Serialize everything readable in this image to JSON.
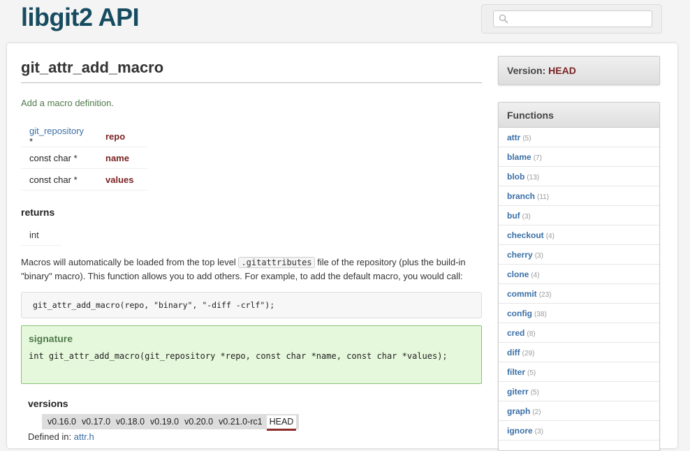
{
  "header": {
    "site_title": "libgit2 API",
    "search_placeholder": ""
  },
  "main": {
    "title": "git_attr_add_macro",
    "summary": "Add a macro definition.",
    "params": [
      {
        "type": "git_repository",
        "type_is_link": true,
        "type_suffix": " *",
        "name": "repo"
      },
      {
        "type": "const char *",
        "type_is_link": false,
        "type_suffix": "",
        "name": "name"
      },
      {
        "type": "const char *",
        "type_is_link": false,
        "type_suffix": "",
        "name": "values"
      }
    ],
    "returns_heading": "returns",
    "returns_type": "int",
    "description_before": "Macros will automatically be loaded from the top level ",
    "description_code": ".gitattributes",
    "description_after": " file of the repository (plus the build-in \"binary\" macro). This function allows you to add others. For example, to add the default macro, you would call:",
    "example_code": "git_attr_add_macro(repo, \"binary\", \"-diff -crlf\");",
    "signature_heading": "signature",
    "signature_code": "int git_attr_add_macro(git_repository *repo, const char *name, const char *values);",
    "versions_heading": "versions",
    "versions": [
      "v0.16.0",
      "v0.17.0",
      "v0.18.0",
      "v0.19.0",
      "v0.20.0",
      "v0.21.0-rc1"
    ],
    "current_version": "HEAD",
    "defined_in_label": "Defined in:",
    "defined_in_file": "attr.h"
  },
  "sidebar": {
    "version_label": "Version:",
    "version_value": "HEAD",
    "functions_title": "Functions",
    "functions": [
      {
        "name": "attr",
        "count": "(5)"
      },
      {
        "name": "blame",
        "count": "(7)"
      },
      {
        "name": "blob",
        "count": "(13)"
      },
      {
        "name": "branch",
        "count": "(11)"
      },
      {
        "name": "buf",
        "count": "(3)"
      },
      {
        "name": "checkout",
        "count": "(4)"
      },
      {
        "name": "cherry",
        "count": "(3)"
      },
      {
        "name": "clone",
        "count": "(4)"
      },
      {
        "name": "commit",
        "count": "(23)"
      },
      {
        "name": "config",
        "count": "(38)"
      },
      {
        "name": "cred",
        "count": "(8)"
      },
      {
        "name": "diff",
        "count": "(29)"
      },
      {
        "name": "filter",
        "count": "(5)"
      },
      {
        "name": "giterr",
        "count": "(5)"
      },
      {
        "name": "graph",
        "count": "(2)"
      },
      {
        "name": "ignore",
        "count": "(3)"
      }
    ]
  },
  "colors": {
    "title": "#174c60",
    "link": "#3a6fa6",
    "param_name": "#7a2323",
    "summary": "#4f7b4a",
    "signature_bg": "#e6f8dc"
  }
}
